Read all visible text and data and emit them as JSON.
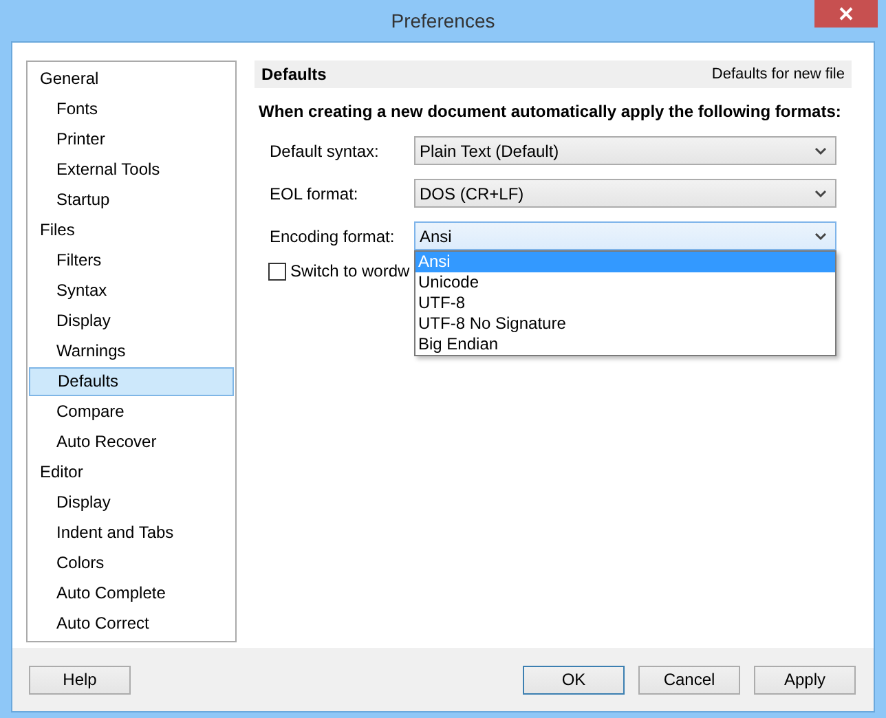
{
  "window": {
    "title": "Preferences"
  },
  "sidebar": {
    "items": [
      {
        "label": "General",
        "selected": false,
        "children": [
          {
            "label": "Fonts",
            "selected": false
          },
          {
            "label": "Printer",
            "selected": false
          },
          {
            "label": "External Tools",
            "selected": false
          },
          {
            "label": "Startup",
            "selected": false
          }
        ]
      },
      {
        "label": "Files",
        "selected": false,
        "children": [
          {
            "label": "Filters",
            "selected": false
          },
          {
            "label": "Syntax",
            "selected": false
          },
          {
            "label": "Display",
            "selected": false
          },
          {
            "label": "Warnings",
            "selected": false
          },
          {
            "label": "Defaults",
            "selected": true
          },
          {
            "label": "Compare",
            "selected": false
          },
          {
            "label": "Auto Recover",
            "selected": false
          }
        ]
      },
      {
        "label": "Editor",
        "selected": false,
        "children": [
          {
            "label": "Display",
            "selected": false
          },
          {
            "label": "Indent and Tabs",
            "selected": false
          },
          {
            "label": "Colors",
            "selected": false
          },
          {
            "label": "Auto Complete",
            "selected": false
          },
          {
            "label": "Auto Correct",
            "selected": false
          }
        ]
      }
    ]
  },
  "panel": {
    "title": "Defaults",
    "subtitle": "Defaults for new file",
    "intro": "When creating a new document automatically apply the following formats:",
    "fields": [
      {
        "label": "Default syntax:",
        "value": "Plain Text (Default)",
        "focused": false
      },
      {
        "label": "EOL format:",
        "value": "DOS (CR+LF)",
        "focused": false
      },
      {
        "label": "Encoding format:",
        "value": "Ansi",
        "focused": true,
        "expanded": true,
        "options": [
          {
            "label": "Ansi",
            "selected": true
          },
          {
            "label": "Unicode",
            "selected": false
          },
          {
            "label": "UTF-8",
            "selected": false
          },
          {
            "label": "UTF-8 No Signature",
            "selected": false
          },
          {
            "label": "Big Endian",
            "selected": false
          }
        ]
      }
    ],
    "checkbox": {
      "label": "Switch to wordw",
      "checked": false
    }
  },
  "help_button": {
    "label": "Help"
  },
  "buttons": [
    {
      "label": "OK",
      "default": true
    },
    {
      "label": "Cancel",
      "default": false
    },
    {
      "label": "Apply",
      "default": false
    }
  ]
}
